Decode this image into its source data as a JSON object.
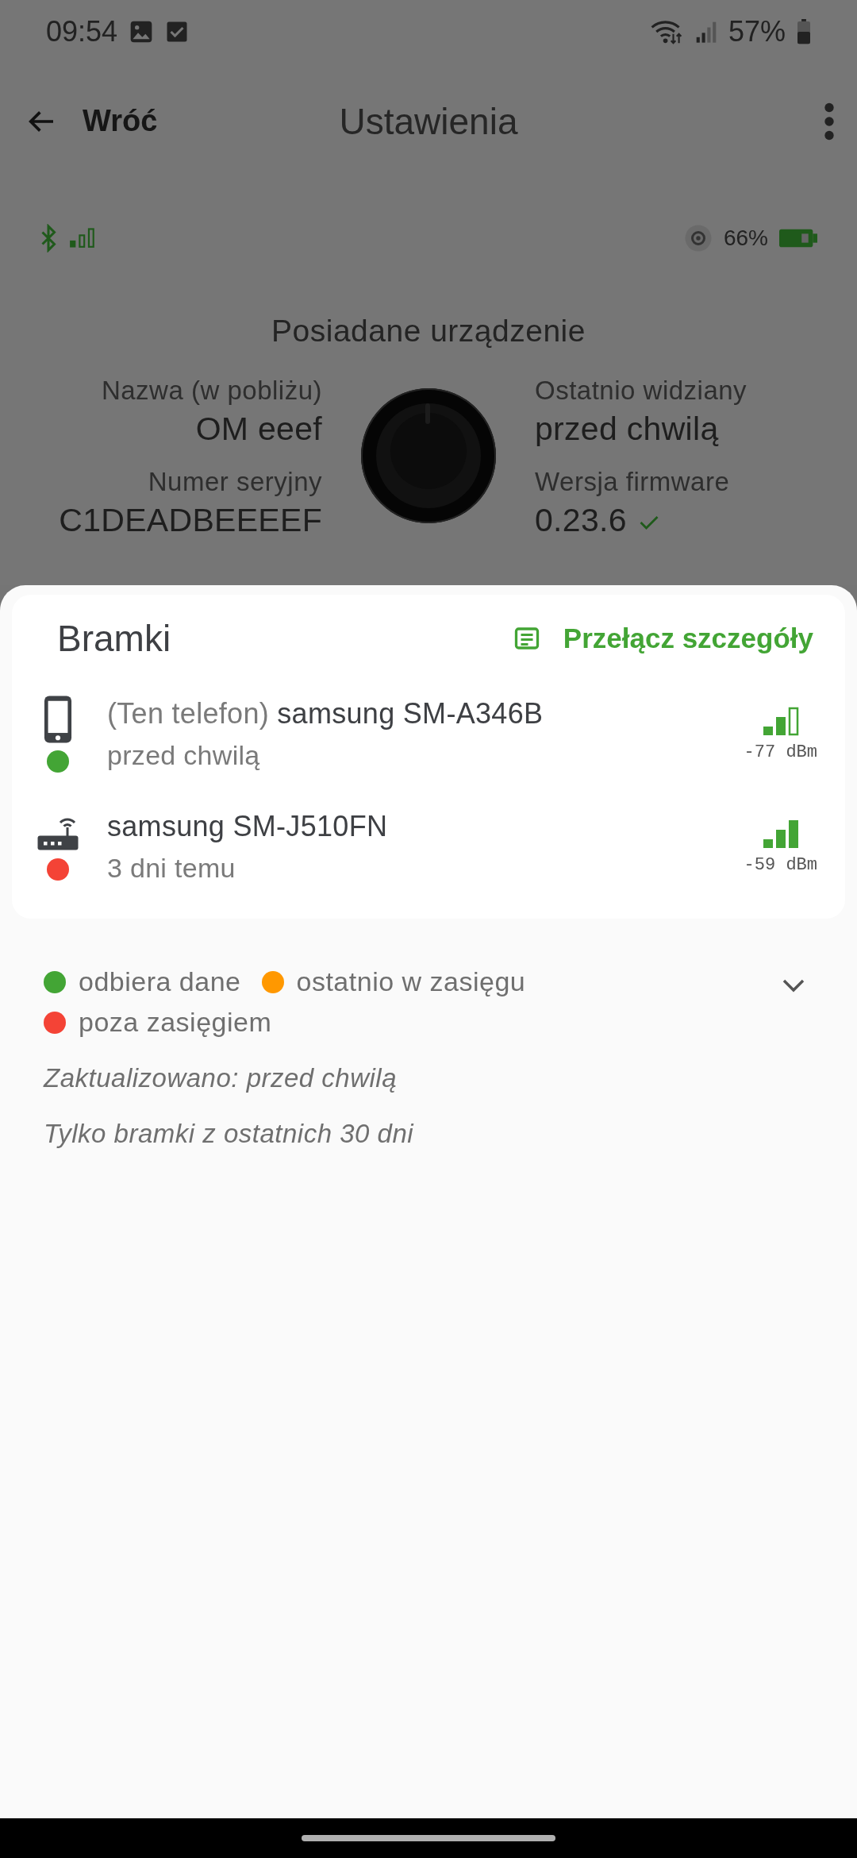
{
  "status_bar": {
    "time": "09:54",
    "battery": "57%"
  },
  "app_bar": {
    "back_label": "Wróć",
    "title": "Ustawienia"
  },
  "device_status": {
    "bluetooth": true,
    "battery": "66%"
  },
  "device": {
    "heading": "Posiadane urządzenie",
    "kind": "picture",
    "fields_left": [
      {
        "label": "Nazwa (w pobliżu)",
        "value": "OM eeef"
      },
      {
        "label": "Numer seryjny",
        "value": "C1DEADBEEEEF"
      }
    ],
    "fields_right": [
      {
        "label": "Ostatnio widziany",
        "value": "przed chwilą"
      },
      {
        "label": "Wersja firmware",
        "value": "0.23.6",
        "up_to_date": true
      }
    ]
  },
  "gateways_card": {
    "title": "Bramki",
    "toggle_button": "Przełącz szczegóły",
    "gateways": [
      {
        "kind": "phone",
        "prefix": "(Ten telefon)",
        "name": "samsung SM-A346B",
        "seen": "przed chwilą",
        "color": "#43a535",
        "full_signal": false,
        "reading": "-77 dBm"
      },
      {
        "kind": "router",
        "name": "samsung SM-J510FN",
        "seen": "3 dni temu",
        "color": "#f44336",
        "full_signal": true,
        "reading": "-59 dBm"
      }
    ]
  },
  "legend": {
    "expanded": false,
    "items": [
      {
        "label": "odbiera dane",
        "color": "#43a535"
      },
      {
        "label": "ostatnio w zasięgu",
        "color": "#ff9800"
      },
      {
        "label": "poza zasięgiem",
        "color": "#f44336"
      }
    ]
  },
  "updated": "Zaktualizowano: przed chwilą",
  "note": "Tylko bramki z ostatnich 30 dni"
}
